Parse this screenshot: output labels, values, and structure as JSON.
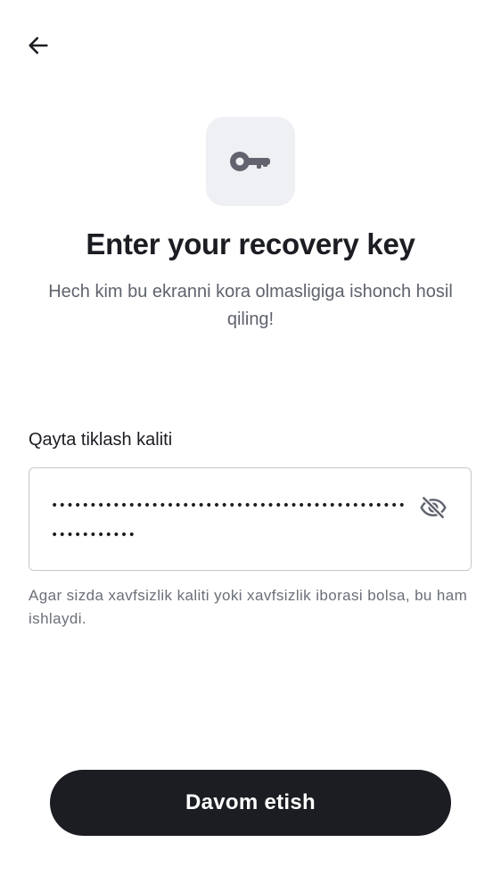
{
  "header": {
    "back_icon": "arrow-left-icon"
  },
  "hero": {
    "icon": "key-icon",
    "title": "Enter your recovery key",
    "subtitle": "Hech kim bu ekranni kora olmasligiga ishonch hosil qiling!"
  },
  "form": {
    "label": "Qayta tiklash kaliti",
    "value": "•••••••••••••••••••••••••••••••••••••••••••••••••••••••••",
    "visibility_icon": "eye-off-icon",
    "hint": "Agar sizda xavfsizlik kaliti yoki xavfsizlik iborasi bolsa, bu ham ishlaydi."
  },
  "actions": {
    "continue_label": "Davom etish"
  },
  "colors": {
    "text_primary": "#1b1d22",
    "text_secondary": "#5f636d",
    "icon_tile": "#eff0f4",
    "button_bg": "#1b1d22"
  }
}
